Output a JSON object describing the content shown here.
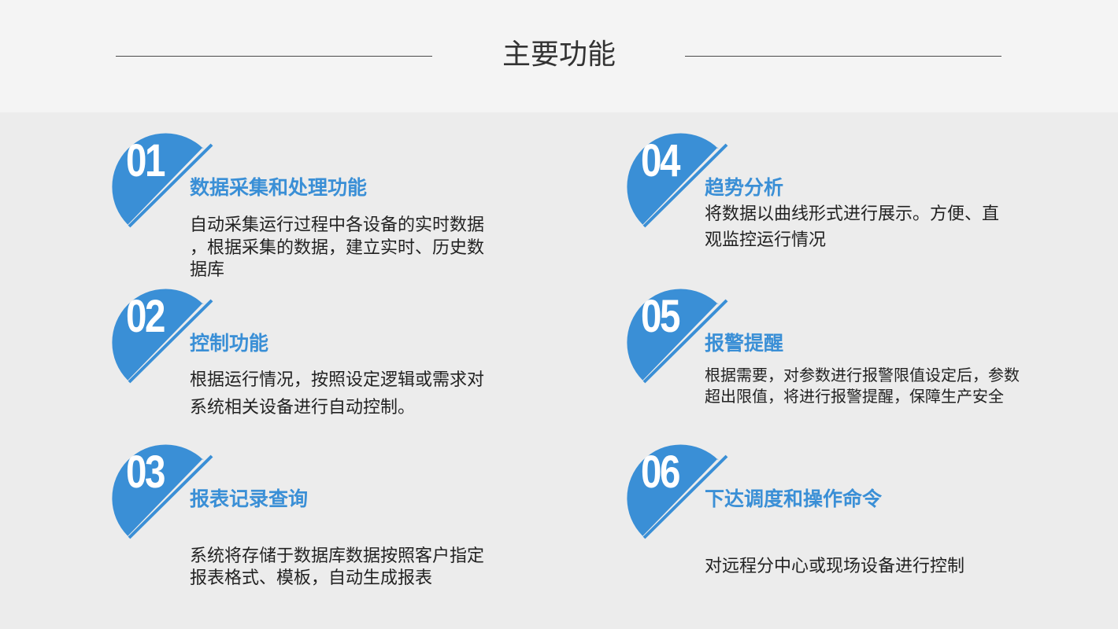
{
  "page": {
    "title": "主要功能"
  },
  "colors": {
    "accent": "#3a8fd6",
    "text": "#222222",
    "background": "#ececec",
    "header_bg": "#f4f4f4"
  },
  "features": [
    {
      "number": "01",
      "title": "数据采集和处理功能",
      "lines": [
        "自动采集运行过程中各设备的实时数据",
        "，根据采集的数据，建立实时、历史数",
        "据库"
      ]
    },
    {
      "number": "02",
      "title": "控制功能",
      "lines": [
        "根据运行情况，按照设定逻辑或需求对",
        "系统相关设备进行自动控制。"
      ]
    },
    {
      "number": "03",
      "title": "报表记录查询",
      "lines": [
        "系统将存储于数据库数据按照客户指定",
        "报表格式、模板，自动生成报表"
      ]
    },
    {
      "number": "04",
      "title": "趋势分析",
      "lines": [
        "将数据以曲线形式进行展示。方便、直",
        "观监控运行情况"
      ]
    },
    {
      "number": "05",
      "title": "报警提醒",
      "lines": [
        "根据需要，对参数进行报警限值设定后，参数",
        "超出限值，将进行报警提醒，保障生产安全"
      ]
    },
    {
      "number": "06",
      "title": "下达调度和操作命令",
      "lines": [
        "对远程分中心或现场设备进行控制"
      ]
    }
  ]
}
